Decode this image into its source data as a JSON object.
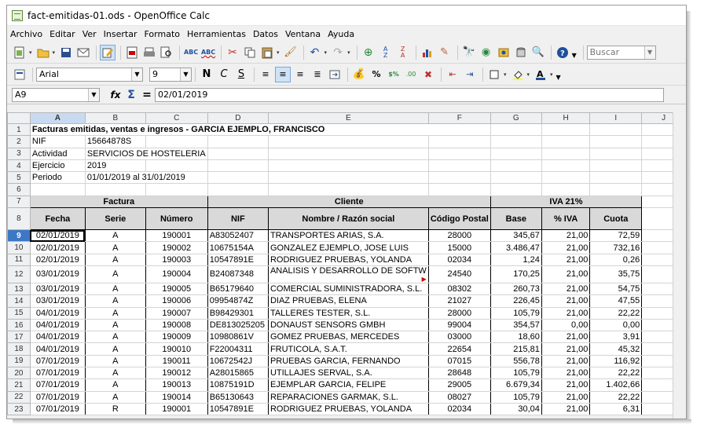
{
  "window": {
    "title": "fact-emitidas-01.ods - OpenOffice Calc"
  },
  "menu": [
    "Archivo",
    "Editar",
    "Ver",
    "Insertar",
    "Formato",
    "Herramientas",
    "Datos",
    "Ventana",
    "Ayuda"
  ],
  "toolbar": {
    "search_placeholder": "Buscar"
  },
  "format": {
    "font": "Arial",
    "size": "9"
  },
  "formula": {
    "cell_ref": "A9",
    "fx": "fx",
    "sum": "Σ",
    "eq": "=",
    "value": "02/01/2019"
  },
  "columns": [
    "A",
    "B",
    "C",
    "D",
    "E",
    "F",
    "G",
    "H",
    "I",
    "J"
  ],
  "sheet": {
    "title": "Facturas emitidas, ventas e ingresos - GARCIA EJEMPLO, FRANCISCO",
    "info": [
      [
        "NIF",
        "15664878S"
      ],
      [
        "Actividad",
        "SERVICIOS DE HOSTELERIA"
      ],
      [
        "Ejercicio",
        "2019"
      ],
      [
        "Periodo",
        "01/01/2019 al 31/01/2019"
      ]
    ],
    "groups": {
      "factura": "Factura",
      "cliente": "Cliente",
      "iva": "IVA 21%"
    },
    "headers": [
      "Fecha",
      "Serie",
      "Número",
      "NIF",
      "Nombre / Razón social",
      "Código Postal",
      "Base",
      "% IVA",
      "Cuota"
    ],
    "rows": [
      [
        "02/01/2019",
        "A",
        "190001",
        "A83052407",
        "TRANSPORTES ARIAS, S.A.",
        "28000",
        "345,67",
        "21,00",
        "72,59"
      ],
      [
        "02/01/2019",
        "A",
        "190002",
        "10675154A",
        "GONZALEZ EJEMPLO, JOSE LUIS",
        "15000",
        "3.486,47",
        "21,00",
        "732,16"
      ],
      [
        "02/01/2019",
        "A",
        "190003",
        "10547891E",
        "RODRIGUEZ PRUEBAS, YOLANDA",
        "02034",
        "1,24",
        "21,00",
        "0,26"
      ],
      [
        "03/01/2019",
        "A",
        "190004",
        "B24087348",
        "ANALISIS Y DESARROLLO DE SOFTW",
        "24540",
        "170,25",
        "21,00",
        "35,75"
      ],
      [
        "03/01/2019",
        "A",
        "190005",
        "B65179640",
        "COMERCIAL SUMINISTRADORA, S.L.",
        "08302",
        "260,73",
        "21,00",
        "54,75"
      ],
      [
        "03/01/2019",
        "A",
        "190006",
        "09954874Z",
        "DIAZ PRUEBAS, ELENA",
        "21027",
        "226,45",
        "21,00",
        "47,55"
      ],
      [
        "04/01/2019",
        "A",
        "190007",
        "B98429301",
        "TALLERES TESTER, S.L.",
        "28000",
        "105,79",
        "21,00",
        "22,22"
      ],
      [
        "04/01/2019",
        "A",
        "190008",
        "DE813025205",
        "DONAUST SENSORS GMBH",
        "99004",
        "354,57",
        "0,00",
        "0,00"
      ],
      [
        "04/01/2019",
        "A",
        "190009",
        "10980861V",
        "GOMEZ PRUEBAS, MERCEDES",
        "03000",
        "18,60",
        "21,00",
        "3,91"
      ],
      [
        "04/01/2019",
        "A",
        "190010",
        "F22004311",
        "FRUTICOLA, S.A.T.",
        "22654",
        "215,81",
        "21,00",
        "45,32"
      ],
      [
        "07/01/2019",
        "A",
        "190011",
        "10672542J",
        "PRUEBAS GARCIA, FERNANDO",
        "07015",
        "556,78",
        "21,00",
        "116,92"
      ],
      [
        "07/01/2019",
        "A",
        "190012",
        "A28015865",
        "UTILLAJES SERVAL, S.A.",
        "28648",
        "105,79",
        "21,00",
        "22,22"
      ],
      [
        "07/01/2019",
        "A",
        "190013",
        "10875191D",
        "EJEMPLAR GARCIA, FELIPE",
        "29005",
        "6.679,34",
        "21,00",
        "1.402,66"
      ],
      [
        "07/01/2019",
        "A",
        "190014",
        "B65130643",
        "REPARACIONES GARMAK, S.L.",
        "08027",
        "105,79",
        "21,00",
        "22,22"
      ],
      [
        "07/01/2019",
        "R",
        "190001",
        "10547891E",
        "RODRIGUEZ PRUEBAS, YOLANDA",
        "02034",
        "30,04",
        "21,00",
        "6,31"
      ]
    ]
  }
}
